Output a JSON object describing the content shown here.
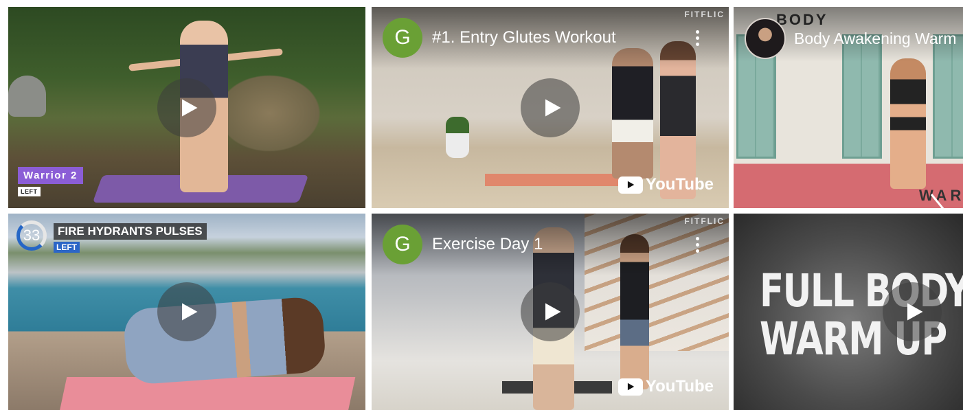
{
  "tiles": [
    {
      "id": "warrior-2",
      "tag": "Warrior 2",
      "side": "LEFT"
    },
    {
      "id": "entry-glutes",
      "channel_initial": "G",
      "title": "#1. Entry Glutes Workout",
      "watermark": "FITFLIC",
      "brand": "YouTube"
    },
    {
      "id": "body-awakening",
      "overlay_text": "BODY",
      "title": "Body Awakening Warm",
      "bottom_text": "WAR"
    },
    {
      "id": "fire-hydrants",
      "timer": "33",
      "caption": "FIRE HYDRANTS PULSES",
      "side": "LEFT"
    },
    {
      "id": "exercise-day-1",
      "channel_initial": "G",
      "title": "Exercise Day 1",
      "watermark": "FITFLIC",
      "brand": "YouTube"
    },
    {
      "id": "full-body-warm-up",
      "line1": "FULL BODY",
      "line2": "WARM UP"
    }
  ],
  "icons": {
    "play": "play-icon",
    "more": "more-vertical-icon",
    "next": "chevron-right-icon"
  },
  "colors": {
    "yt_avatar": "#6aa035",
    "warrior_tag": "#8b5dd6",
    "left_badge": "#2c66c7"
  }
}
